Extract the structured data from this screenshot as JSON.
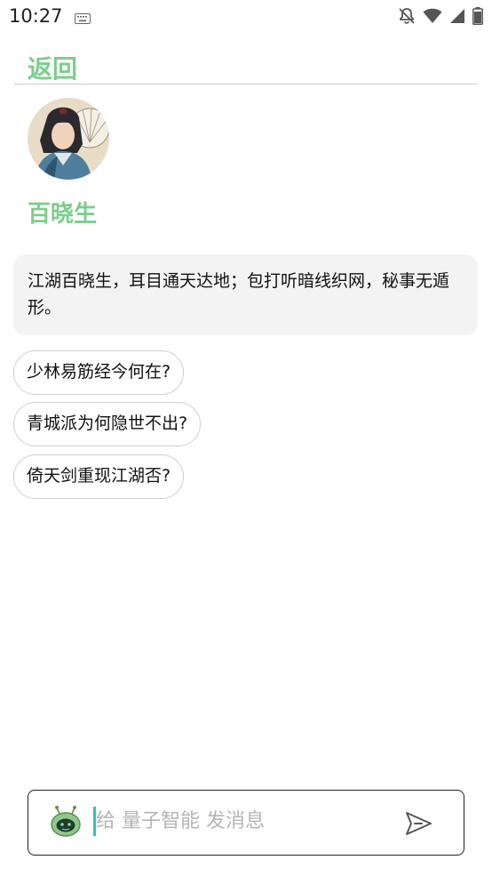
{
  "status_bar": {
    "time": "10:27",
    "icons": [
      "keyboard-icon",
      "notifications-off-icon",
      "wifi-icon",
      "signal-icon",
      "battery-icon"
    ]
  },
  "header": {
    "back_label": "返回"
  },
  "bot": {
    "name": "百晓生",
    "avatar_icon": "character-portrait-avatar",
    "intro": "江湖百晓生，耳目通天达地；包打听暗线织网，秘事无遁形。"
  },
  "suggestions": [
    "少林易筋经今何在?",
    "青城派为何隐世不出?",
    "倚天剑重现江湖否?"
  ],
  "composer": {
    "placeholder": "给 量子智能 发消息",
    "value": "",
    "bot_icon": "robot-icon",
    "send_icon": "send-icon"
  },
  "colors": {
    "accent": "#7ccf8a",
    "cursor": "#2ec4b6",
    "bubble_bg": "#f3f3f3"
  }
}
